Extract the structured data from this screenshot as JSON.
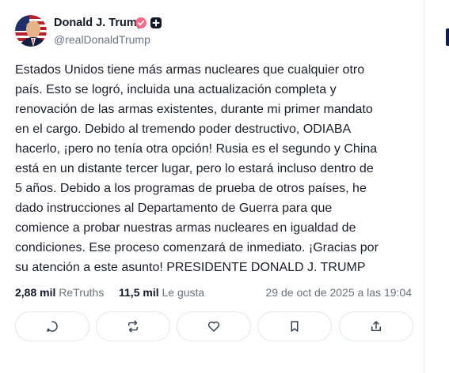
{
  "post": {
    "author": {
      "name": "Donald J. Trump",
      "handle": "@realDonaldTrump",
      "verified_color": "#f76b8a"
    },
    "body_lines": [
      "Estados Unidos tiene más armas nucleares que cualquier otro",
      "país. Esto se logró, incluida una actualización completa y",
      "renovación de las armas existentes, durante mi primer mandato",
      "en el cargo. Debido al tremendo poder destructivo, ODIABA",
      "hacerlo, ¡pero no tenía otra opción! Rusia es el segundo y China",
      "está en un distante tercer lugar, pero lo estará incluso dentro de",
      "5 años. Debido a los programas de prueba de otros países, he",
      "dado instrucciones al Departamento de Guerra para que",
      "comience a probar nuestras armas nucleares en igualdad de",
      "condiciones. Ese proceso comenzará de inmediato. ¡Gracias por",
      "su atención a este asunto! PRESIDENTE DONALD J. TRUMP"
    ],
    "stats": {
      "retruths_count": "2,88 mil",
      "retruths_label": "ReTruths",
      "likes_count": "11,5 mil",
      "likes_label": "Le gusta"
    },
    "date": "29 de oct de 2025 a las 19:04",
    "actions": [
      {
        "icon": "reply-icon"
      },
      {
        "icon": "retruth-icon"
      },
      {
        "icon": "heart-icon"
      },
      {
        "icon": "bookmark-icon"
      },
      {
        "icon": "share-icon"
      }
    ]
  },
  "colors": {
    "text": "#1a1f2b",
    "muted": "#6b7280",
    "border": "#e3e6ec"
  }
}
